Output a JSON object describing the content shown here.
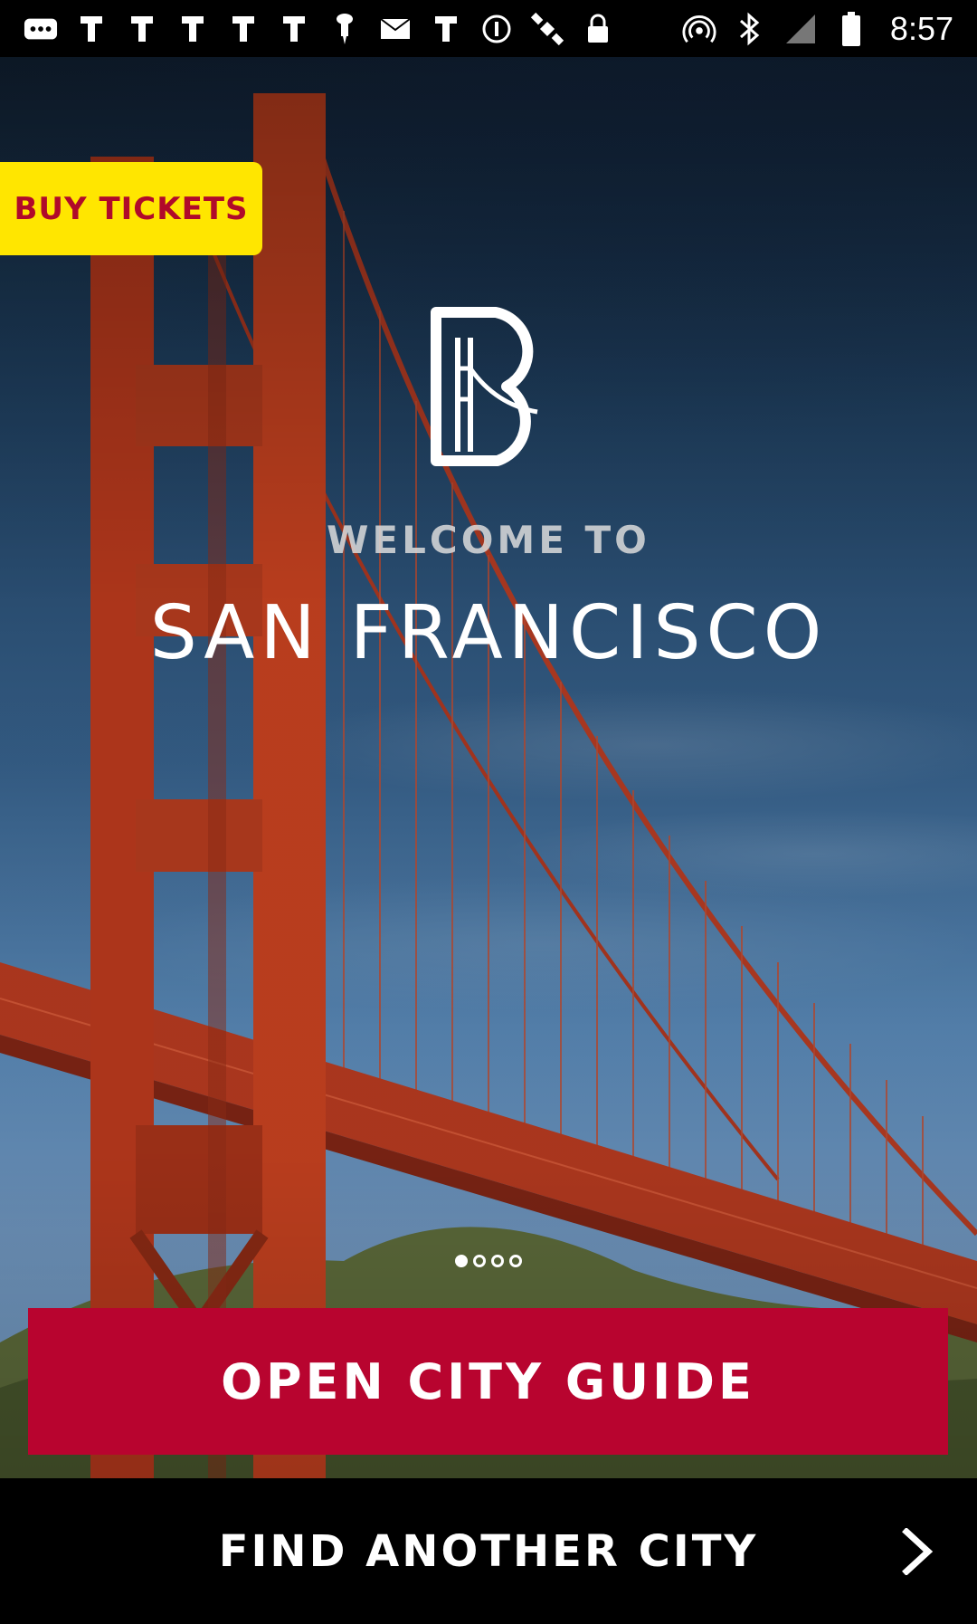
{
  "status_bar": {
    "time": "8:57",
    "left_icons": [
      "more-dots-icon",
      "notification-icon",
      "notification-icon",
      "notification-icon",
      "notification-icon",
      "notification-icon",
      "pin-icon",
      "mail-icon",
      "notification-icon",
      "info-icon",
      "satellite-fake-icon",
      "lock-icon"
    ],
    "right_icons": [
      "hotspot-icon",
      "bluetooth-icon",
      "no-signal-icon",
      "battery-icon"
    ]
  },
  "header": {
    "buy_tickets_label": "BUY TICKETS"
  },
  "hero": {
    "welcome_label": "WELCOME TO",
    "city_name": "SAN FRANCISCO"
  },
  "pager": {
    "total": 4,
    "active_index": 0
  },
  "actions": {
    "open_guide_label": "OPEN CITY GUIDE",
    "find_city_label": "FIND ANOTHER CITY"
  },
  "colors": {
    "accent_red": "#b8042f",
    "ticket_yellow": "#ffe600",
    "ticket_text": "#b00a2a"
  }
}
